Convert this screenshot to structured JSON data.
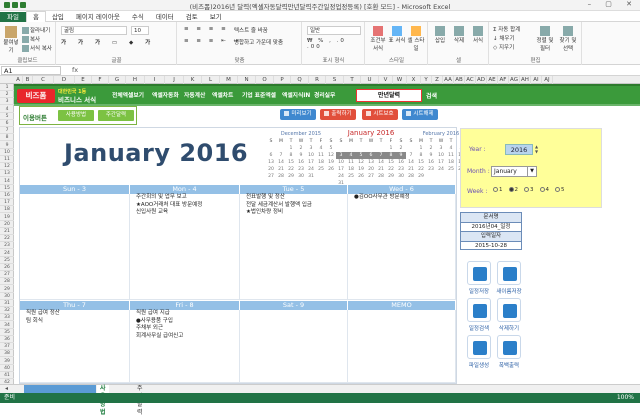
{
  "window": {
    "title": "(비즈폼)2016년 달력(엑셀자동달력만년달력주간일정업정등록) [호환 모드] - Microsoft Excel"
  },
  "ribbon_tabs": [
    "파일",
    "홈",
    "삽입",
    "페이지 레이아웃",
    "수식",
    "데이터",
    "검토",
    "보기"
  ],
  "ribbon": {
    "clipboard": {
      "paste": "붙여넣기",
      "cut": "잘라내기",
      "copy": "복사",
      "format_painter": "서식 복사",
      "label": "클립보드"
    },
    "font": {
      "name": "굴림",
      "size": "10",
      "label": "글꼴"
    },
    "align": {
      "wrap": "텍스트 줄 바꿈",
      "merge": "병합하고 가운데 맞춤",
      "label": "맞춤"
    },
    "number": {
      "format": "일반",
      "label": "표시 형식"
    },
    "styles": {
      "conditional": "조건부 서식",
      "table": "표 서식",
      "cell": "셀 스타일",
      "label": "스타일"
    },
    "cells": {
      "insert": "삽입",
      "delete": "삭제",
      "format": "서식",
      "label": "셀"
    },
    "editing": {
      "autosum": "자동 합계",
      "fill": "채우기",
      "clear": "지우기",
      "sort": "정렬 및 필터",
      "find": "찾기 및 선택",
      "label": "편집"
    }
  },
  "formula": {
    "namebox": "A1",
    "fx": "fx"
  },
  "columns": [
    "A",
    "B",
    "C",
    "D",
    "E",
    "F",
    "G",
    "H",
    "I",
    "J",
    "K",
    "L",
    "M",
    "N",
    "O",
    "P",
    "Q",
    "R",
    "S",
    "T",
    "U",
    "V",
    "W",
    "X",
    "Y",
    "Z",
    "AA",
    "AB",
    "AC",
    "AD",
    "AE",
    "AF",
    "AG",
    "AH",
    "AI",
    "AJ"
  ],
  "rows": [
    "1",
    "2",
    "3",
    "4",
    "5",
    "6",
    "7",
    "8",
    "9",
    "10",
    "11",
    "12",
    "13",
    "14",
    "15",
    "16",
    "17",
    "18",
    "19",
    "20",
    "21",
    "22",
    "23",
    "24",
    "25",
    "26",
    "27",
    "28",
    "29",
    "30",
    "31",
    "32",
    "33",
    "34",
    "35",
    "36",
    "37",
    "38",
    "39",
    "40",
    "41",
    "42"
  ],
  "header": {
    "logo": "비즈폼",
    "logo_sub1": "대한민국 1등",
    "logo_sub2": "비즈니스 서식",
    "nav": [
      "전체엑셀보기",
      "엑셀자동화",
      "자동계산",
      "엑셀차트",
      "기업 표준엑셀",
      "엑셀지식iN",
      "경리실무"
    ],
    "search_value": "만년달력",
    "search_button": "검색"
  },
  "toolbar": {
    "usage": "이용버튼",
    "pill1": "사용방법",
    "pill2": "주간달력",
    "actions": [
      {
        "label": "미리보기",
        "color": "#3f88cf"
      },
      {
        "label": "출력하기",
        "color": "#e14f3b"
      },
      {
        "label": "시트보호",
        "color": "#e14f3b"
      },
      {
        "label": "시트해제",
        "color": "#3f88cf"
      }
    ]
  },
  "calendar": {
    "title": "January 2016",
    "mini": [
      {
        "title": "December 2015",
        "current": false,
        "head": [
          "S",
          "M",
          "T",
          "W",
          "T",
          "F",
          "S"
        ],
        "rows": [
          [
            "",
            "",
            "1",
            "2",
            "3",
            "4",
            "5"
          ],
          [
            "6",
            "7",
            "8",
            "9",
            "10",
            "11",
            "12"
          ],
          [
            "13",
            "14",
            "15",
            "16",
            "17",
            "18",
            "19"
          ],
          [
            "20",
            "21",
            "22",
            "23",
            "24",
            "25",
            "26"
          ],
          [
            "27",
            "28",
            "29",
            "30",
            "31",
            "",
            ""
          ]
        ]
      },
      {
        "title": "January 2016",
        "current": true,
        "head": [
          "S",
          "M",
          "T",
          "W",
          "T",
          "F",
          "S"
        ],
        "rows": [
          [
            "",
            "",
            "",
            "",
            "",
            "1",
            "2"
          ],
          [
            "3",
            "4",
            "5",
            "6",
            "7",
            "8",
            "9"
          ],
          [
            "10",
            "11",
            "12",
            "13",
            "14",
            "15",
            "16"
          ],
          [
            "17",
            "18",
            "19",
            "20",
            "21",
            "22",
            "23"
          ],
          [
            "24",
            "25",
            "26",
            "27",
            "28",
            "29",
            "30"
          ],
          [
            "31",
            "",
            "",
            "",
            "",
            "",
            ""
          ]
        ]
      },
      {
        "title": "February 2016",
        "current": false,
        "head": [
          "S",
          "M",
          "T",
          "W",
          "T",
          "F",
          "S"
        ],
        "rows": [
          [
            "",
            "1",
            "2",
            "3",
            "4",
            "5",
            "6"
          ],
          [
            "7",
            "8",
            "9",
            "10",
            "11",
            "12",
            "13"
          ],
          [
            "14",
            "15",
            "16",
            "17",
            "18",
            "19",
            "20"
          ],
          [
            "21",
            "22",
            "23",
            "24",
            "25",
            "26",
            "27"
          ],
          [
            "28",
            "29",
            "",
            "",
            "",
            "",
            ""
          ]
        ]
      }
    ],
    "days_top": [
      "Sun - 3",
      "Mon - 4",
      "Tue - 5",
      "Wed - 6"
    ],
    "days_bottom": [
      "Thu - 7",
      "Fri - 8",
      "Sat - 9",
      "MEMO"
    ],
    "entries_top": [
      [],
      [
        "주간회의 및 업무 보고",
        "★AOO거래처 대표 방문예정",
        "신입사원 교육"
      ],
      [
        "전표발행 및 정산",
        "전달 세금계산서 발행액 입금",
        "★법인차량 정비"
      ],
      [
        "●김OO사무관 방문예정"
      ]
    ],
    "entries_bottom": [
      [
        "직원 급여 정산",
        "팀 회식"
      ],
      [
        "직원 급여 지급",
        "●사무용품 구입",
        "주채부 외근",
        "회계사무실 급여신고"
      ],
      [],
      []
    ]
  },
  "controls": {
    "year_label": "Year :",
    "year": "2016",
    "month_label": "Month :",
    "month": "January",
    "week_label": "Week :",
    "weeks": [
      "1",
      "2",
      "3",
      "4",
      "5"
    ],
    "week_selected": 2
  },
  "approval": {
    "h1": "문서명",
    "v1": "2016년04_일정",
    "h2": "입력일자",
    "v2": "2015-10-28"
  },
  "icons": [
    {
      "label": "일정저장",
      "color": "#2b7fc9"
    },
    {
      "label": "새이름저장",
      "color": "#2b7fc9"
    },
    {
      "label": "일정검색",
      "color": "#2b7fc9"
    },
    {
      "label": "삭제하기",
      "color": "#2b7fc9"
    },
    {
      "label": "파일생성",
      "color": "#2b7fc9"
    },
    {
      "label": "폭백출력",
      "color": "#2b7fc9"
    }
  ],
  "sheets": {
    "active": "사용방법",
    "other": "주간달력"
  },
  "status": {
    "ready": "준비",
    "zoom": "100%"
  }
}
